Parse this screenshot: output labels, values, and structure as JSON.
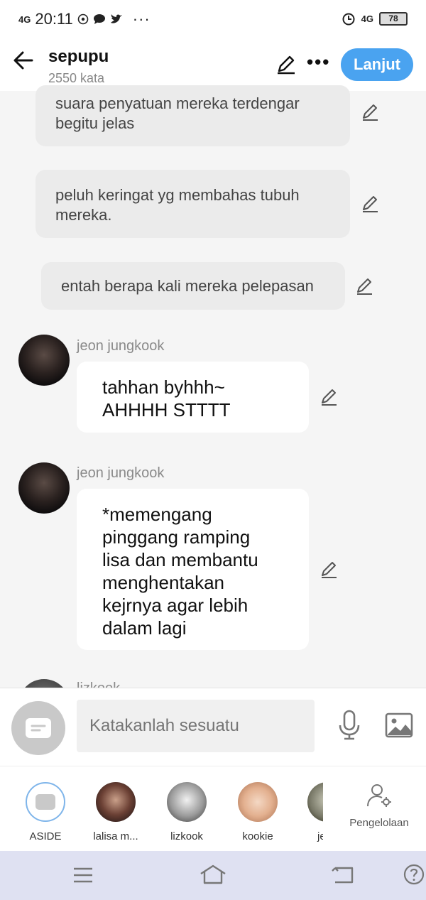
{
  "status": {
    "time": "20:11",
    "signal_left": "4G",
    "signal_right": "4G",
    "battery": "78"
  },
  "header": {
    "title": "sepupu",
    "subtitle": "2550 kata",
    "next_label": "Lanjut"
  },
  "messages": {
    "m1": {
      "lines": [
        "suara penyatuan mereka terdengar",
        "begitu jelas"
      ]
    },
    "m2": {
      "lines": [
        "peluh keringat yg membahas tubuh",
        "mereka."
      ]
    },
    "m3": {
      "text": "entah berapa kali mereka pelepasan"
    },
    "m4": {
      "name": "jeon jungkook",
      "lines": [
        "tahhan byhhh~",
        "AHHHH STTTT"
      ]
    },
    "m5": {
      "name": "jeon jungkook",
      "lines": [
        "*memengang",
        "pinggang ramping",
        "lisa dan membantu",
        "menghentakan",
        "kejrnya agar lebih",
        "dalam lagi"
      ]
    },
    "m6": {
      "name": "lizkook"
    }
  },
  "input": {
    "placeholder": "Katakanlah sesuatu"
  },
  "characters": [
    {
      "label": "ASIDE"
    },
    {
      "label": "lalisa m..."
    },
    {
      "label": "lizkook"
    },
    {
      "label": "kookie"
    },
    {
      "label": "je"
    }
  ],
  "manage_label": "Pengelolaan",
  "icons": {
    "back": "arrow-left-icon",
    "edit": "pencil-icon",
    "more": "more-horizontal-icon",
    "mic": "microphone-icon",
    "image": "image-icon",
    "manage": "user-settings-icon",
    "nav": [
      "menu-icon",
      "home-icon",
      "back-nav-icon",
      "help-icon"
    ]
  },
  "colors": {
    "accent": "#4aa3f0",
    "nav_bg": "#dfe1f2"
  }
}
